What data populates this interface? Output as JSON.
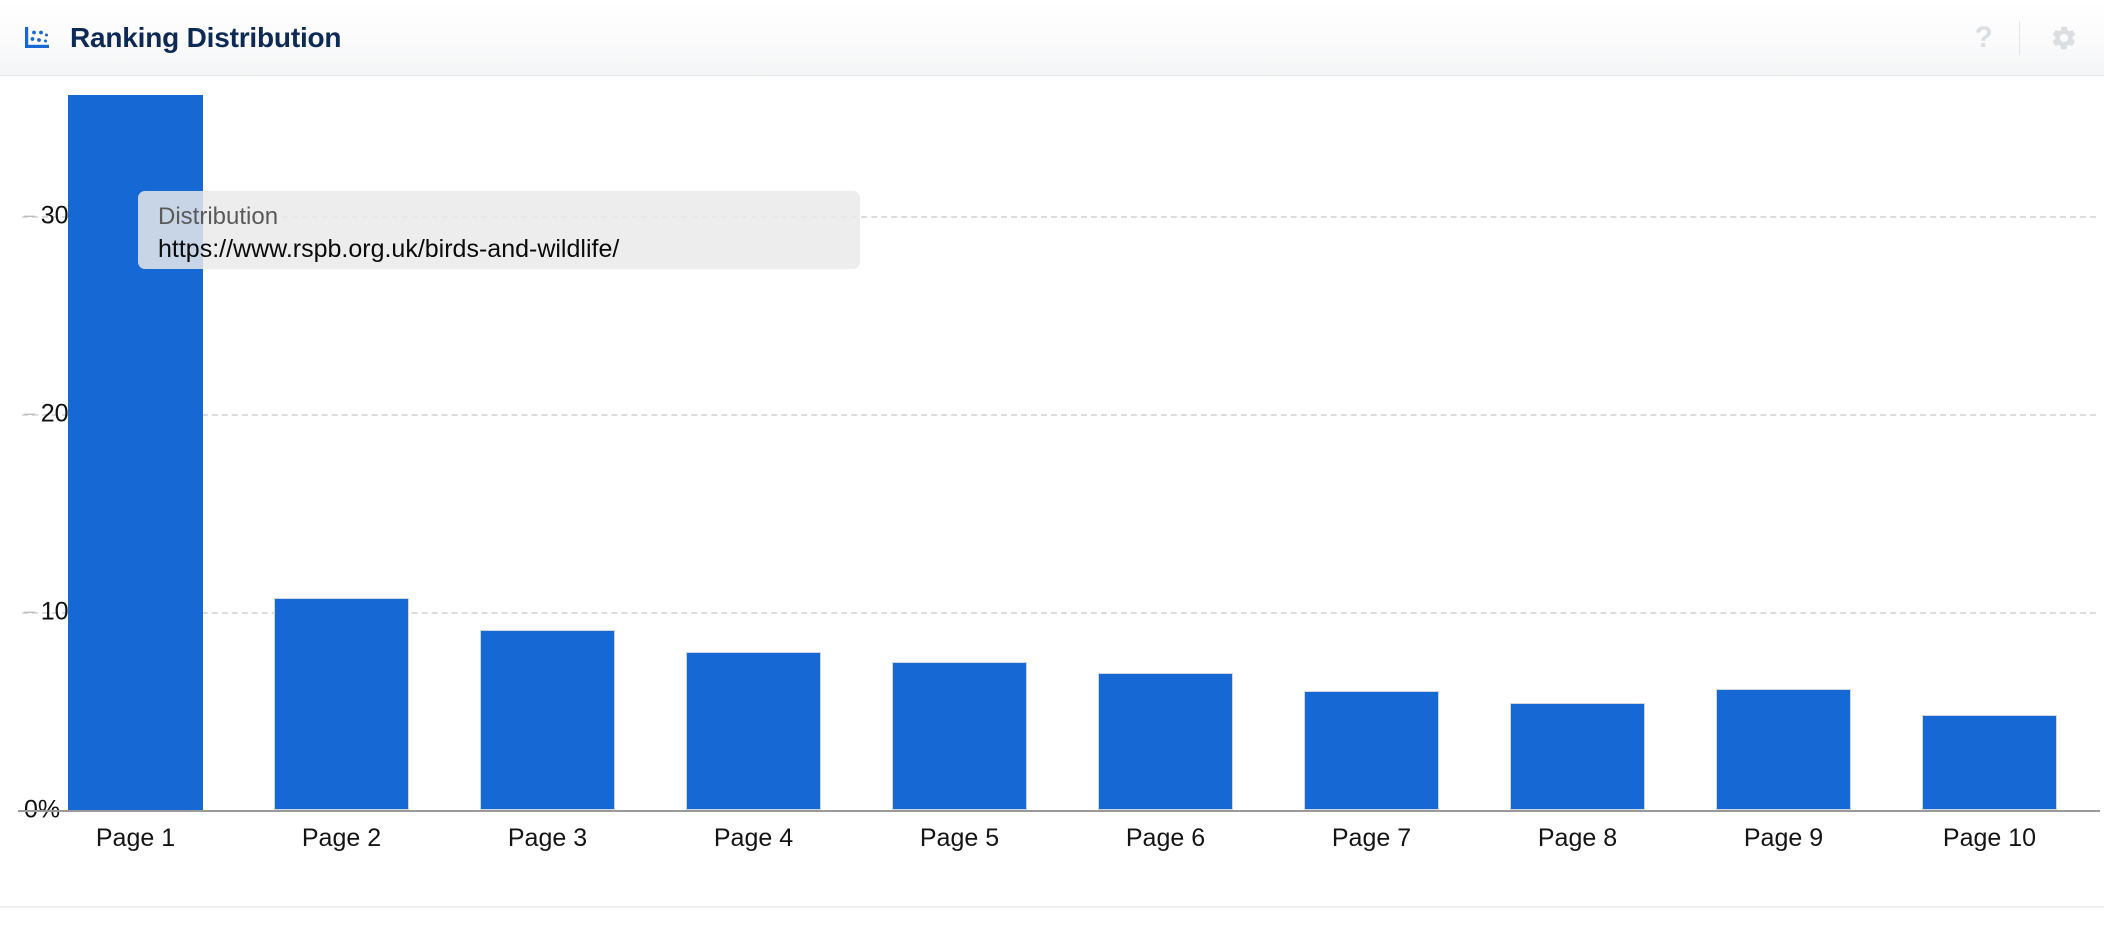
{
  "header": {
    "title": "Ranking Distribution",
    "icon": "scatter-chart-icon",
    "help_label": "?",
    "settings_icon": "gear-icon",
    "accent_color": "#0d2a57"
  },
  "tooltip": {
    "title": "Distribution",
    "value": "https://www.rspb.org.uk/birds-and-wildlife/"
  },
  "chart_data": {
    "type": "bar",
    "title": "Ranking Distribution",
    "xlabel": "",
    "ylabel": "",
    "categories": [
      "Page 1",
      "Page 2",
      "Page 3",
      "Page 4",
      "Page 5",
      "Page 6",
      "Page 7",
      "Page 8",
      "Page 9",
      "Page 10"
    ],
    "values": [
      36.1,
      10.7,
      9.1,
      8.0,
      7.5,
      6.9,
      6.0,
      5.4,
      6.1,
      4.8
    ],
    "series": [
      {
        "name": "Distribution",
        "values": [
          36.1,
          10.7,
          9.1,
          8.0,
          7.5,
          6.9,
          6.0,
          5.4,
          6.1,
          4.8
        ]
      }
    ],
    "ytick_labels": [
      "30%",
      "20%",
      "10%",
      "0%"
    ],
    "ytick_values": [
      30,
      20,
      10,
      0
    ],
    "ylim": [
      0,
      40
    ],
    "grid": true,
    "legend": "none",
    "bar_color": "#1668d4",
    "gridline_color": "#dadcde",
    "axis_color": "#9a9a9a"
  }
}
